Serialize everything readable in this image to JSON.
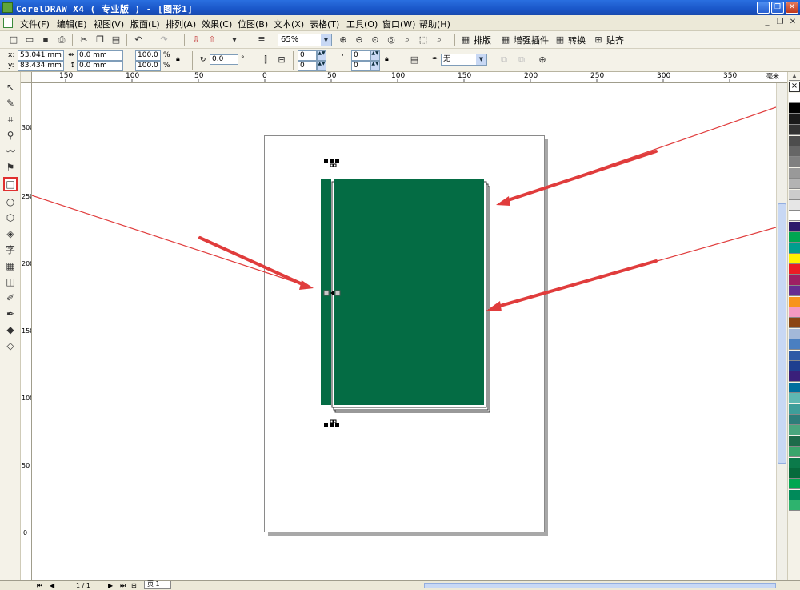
{
  "window": {
    "title": "CorelDRAW X4 ( 专业版 ) - [图形1]",
    "minimize_glyph": "_",
    "restore_glyph": "❐",
    "close_glyph": "✕"
  },
  "menu": {
    "items": [
      "文件(F)",
      "编辑(E)",
      "视图(V)",
      "版面(L)",
      "排列(A)",
      "效果(C)",
      "位图(B)",
      "文本(X)",
      "表格(T)",
      "工具(O)",
      "窗口(W)",
      "帮助(H)"
    ],
    "mdi_minimize_glyph": "_",
    "mdi_restore_glyph": "❐",
    "mdi_close_glyph": "✕"
  },
  "toolbar": {
    "zoom_value": "65%",
    "zoom_dropdown_glyph": "▼",
    "buttons": [
      "排版",
      "增强插件",
      "转换",
      "贴齐"
    ]
  },
  "property_bar": {
    "x_label": "x:",
    "x_value": "53.041 mm",
    "y_label": "y:",
    "y_value": "83.434 mm",
    "width_value": "0.0 mm",
    "height_value": "0.0 mm",
    "scale_x": "100.0",
    "scale_y": "100.0",
    "percent": "%",
    "rotation_value": "0.0",
    "degree": "°",
    "corner_tl": "0",
    "corner_bl": "0",
    "corner_tr": "0",
    "corner_br": "0",
    "outline_value": "无",
    "outline_dropdown_glyph": "▼",
    "spin_glyph": "▲▼"
  },
  "ruler": {
    "h_ticks": [
      "150",
      "100",
      "50",
      "0",
      "50",
      "100",
      "150",
      "200",
      "250",
      "300",
      "350"
    ],
    "h_unit": "毫米",
    "v_ticks": [
      "300",
      "250",
      "200",
      "150",
      "100",
      "50",
      "0"
    ]
  },
  "page_nav": {
    "page_indicator": "1 / 1",
    "page_tab": "页 1"
  },
  "icons": {
    "tools": [
      "pick-tool-icon",
      "shape-tool-icon",
      "crop-tool-icon",
      "zoom-tool-icon",
      "freehand-tool-icon",
      "smart-fill-tool-icon",
      "rectangle-tool-icon",
      "ellipse-tool-icon",
      "polygon-tool-icon",
      "basic-shapes-tool-icon",
      "text-tool-icon",
      "table-tool-icon",
      "interactive-blend-tool-icon",
      "eyedropper-tool-icon",
      "outline-tool-icon",
      "fill-tool-icon",
      "interactive-fill-tool-icon"
    ]
  },
  "colors": {
    "title_bar": "#1a56c8",
    "book_green": "#046c44",
    "arrow_red": "#e03c3c",
    "selected_tool_border": "#e03030"
  },
  "palette": [
    "#ffffff",
    "#000000",
    "#1a1a1a",
    "#333333",
    "#4d4d4d",
    "#666666",
    "#808080",
    "#999999",
    "#b3b3b3",
    "#cccccc",
    "#e6e6e6",
    "#ffffff",
    "#2e1b6b",
    "#00a651",
    "#009e8f",
    "#fff200",
    "#ed1c24",
    "#9e1f63",
    "#662d91",
    "#f7941d",
    "#f49ac1",
    "#8b4513",
    "#a3b8d9",
    "#4a7fc1",
    "#2e5aa6",
    "#1f3f8f",
    "#3a1f7a",
    "#006f9e",
    "#5fb8b2",
    "#3e9e9a",
    "#2e7d7a",
    "#4aa67e",
    "#1e6b4a",
    "#3aa56b",
    "#0b7a4a",
    "#066a3c",
    "#00a650",
    "#008a5a",
    "#2eb36e"
  ]
}
